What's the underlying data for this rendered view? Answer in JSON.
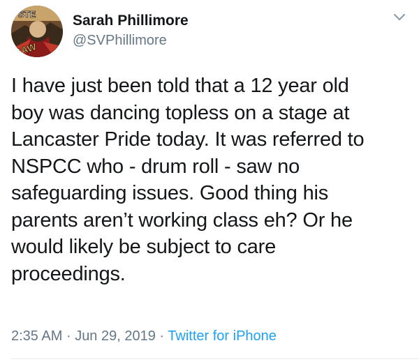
{
  "author": {
    "display_name": "Sarah Phillimore",
    "handle": "@SVPhillimore",
    "avatar_icon": "comic-avatar-icon"
  },
  "menu_icon": "chevron-down-icon",
  "tweet": {
    "text": "I have just been told that a 12 year old\nboy was dancing topless on a stage at\nLancaster Pride today. It was referred to\nNSPCC who - drum roll - saw no\nsafeguarding issues. Good thing his\nparents aren’t working class eh? Or he\nwould likely be subject to care\nproceedings."
  },
  "meta": {
    "time": "2:35 AM",
    "separator": "·",
    "date": "Jun 29, 2019",
    "source": "Twitter for iPhone"
  },
  "colors": {
    "text": "#14171a",
    "secondary": "#657786",
    "link": "#1da1f2"
  }
}
